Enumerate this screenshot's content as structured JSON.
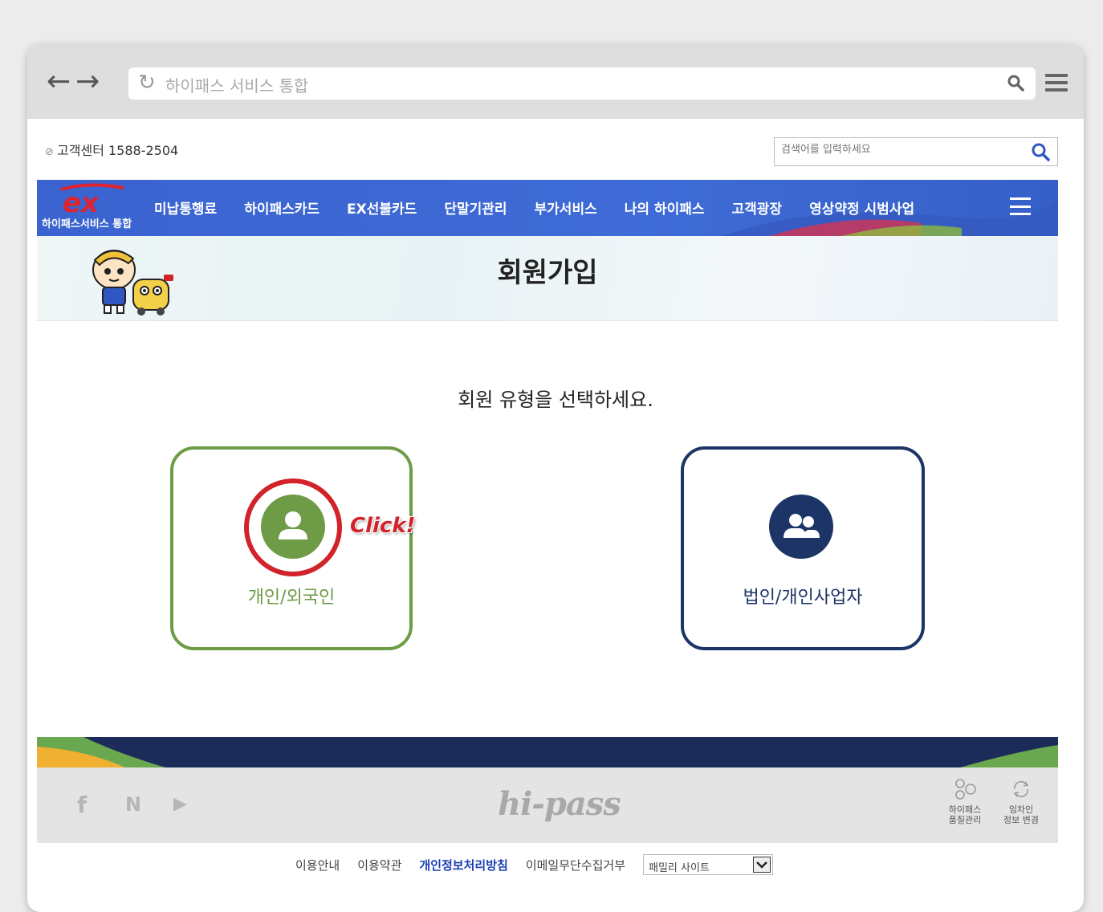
{
  "browser": {
    "address_text": "하이패스 서비스 통합"
  },
  "header": {
    "customer_center": "고객센터 1588-2504",
    "search_placeholder": "검색어를 입력하세요"
  },
  "logo": {
    "mark": "ex",
    "subtitle": "하이패스서비스 통합"
  },
  "nav": {
    "items": [
      {
        "label": "미납통행료"
      },
      {
        "label": "하이패스카드"
      },
      {
        "label": "EX선불카드"
      },
      {
        "label": "단말기관리"
      },
      {
        "label": "부가서비스"
      },
      {
        "label": "나의 하이패스"
      },
      {
        "label": "고객광장"
      },
      {
        "label": "영상약정 시범사업"
      }
    ]
  },
  "hero": {
    "title": "회원가입"
  },
  "main": {
    "prompt": "회원 유형을 선택하세요.",
    "options": [
      {
        "label": "개인/외국인",
        "annotation": "Click!"
      },
      {
        "label": "법인/개인사업자"
      }
    ]
  },
  "footer": {
    "social": [
      "f",
      "N",
      "▶"
    ],
    "brand": "hi-pass",
    "quick_links": [
      {
        "label_line1": "하이패스",
        "label_line2": "품질관리"
      },
      {
        "label_line1": "임차인",
        "label_line2": "정보 변경"
      }
    ],
    "links": [
      {
        "label": "이용안내"
      },
      {
        "label": "이용약관"
      },
      {
        "label": "개인정보처리방침"
      },
      {
        "label": "이메일무단수집거부"
      }
    ],
    "family_site": "패밀리 사이트"
  },
  "colors": {
    "nav_blue": "#3f6bd6",
    "personal_green": "#6d9b46",
    "corp_navy": "#1c3466",
    "click_red": "#d2232a",
    "privacy_link": "#1a3fb5"
  }
}
